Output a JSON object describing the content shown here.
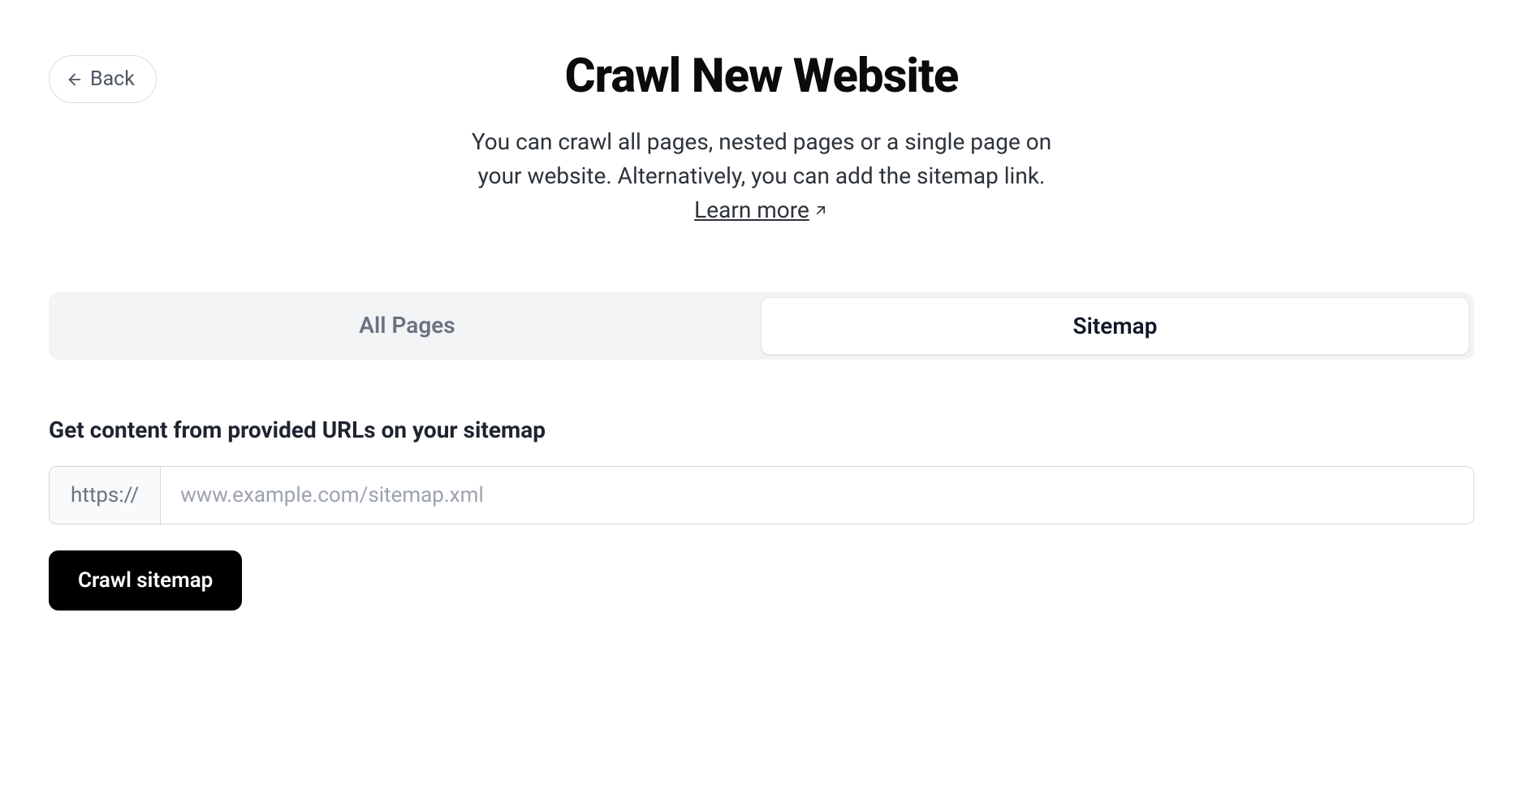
{
  "back": {
    "label": "Back"
  },
  "header": {
    "title": "Crawl New Website",
    "description_before": "You can crawl all pages, nested pages or a single page on your website. Alternatively, you can add the sitemap link. ",
    "learn_more": "Learn more"
  },
  "tabs": {
    "all_pages": "All Pages",
    "sitemap": "Sitemap"
  },
  "form": {
    "label": "Get content from provided URLs on your sitemap",
    "prefix": "https://",
    "placeholder": "www.example.com/sitemap.xml",
    "value": "",
    "submit": "Crawl sitemap"
  }
}
